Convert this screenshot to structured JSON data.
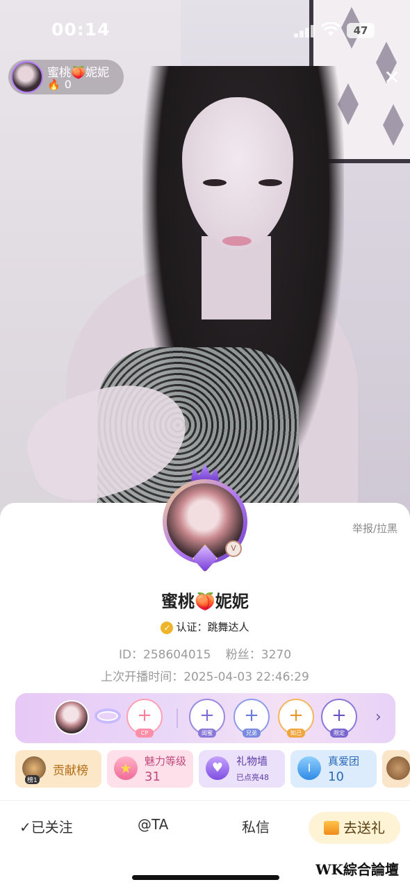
{
  "status_bar": {
    "time": "00:14",
    "battery": "47"
  },
  "host": {
    "name": "蜜桃🍑妮妮",
    "fire_count": "0"
  },
  "profile": {
    "report_label": "举报/拉黑",
    "nickname": "蜜桃🍑妮妮",
    "certification": "认证：跳舞达人",
    "id_label": "ID：258604015",
    "fans_label": "粉丝：3270",
    "last_live": "上次开播时间：2025-04-03 22:46:29"
  },
  "relations": {
    "slots": [
      {
        "tag": "CP",
        "color": "#ff8fa8"
      },
      {
        "tag": "闺蜜",
        "color": "#8a78d8"
      },
      {
        "tag": "兄弟",
        "color": "#7a8ae0"
      },
      {
        "tag": "知己",
        "color": "#f0a640"
      },
      {
        "tag": "限定",
        "color": "#7a66cf"
      }
    ]
  },
  "tiles": [
    {
      "title": "贡献榜",
      "sub": "榜1",
      "bg": "#fde7c9",
      "color": "#b26a12"
    },
    {
      "title": "魅力等级",
      "value": "31",
      "bg": "#fde0ea",
      "color": "#c04a7a"
    },
    {
      "title": "礼物墙",
      "sub": "已点亮48",
      "bg": "#ece1fb",
      "color": "#5a3aa8"
    },
    {
      "title": "真爱团",
      "value": "10",
      "bg": "#dcecfd",
      "color": "#2a6ab8"
    }
  ],
  "actions": {
    "followed": "已关注",
    "mention": "@TA",
    "message": "私信",
    "gift": "去送礼"
  },
  "watermark": "WK綜合論壇"
}
